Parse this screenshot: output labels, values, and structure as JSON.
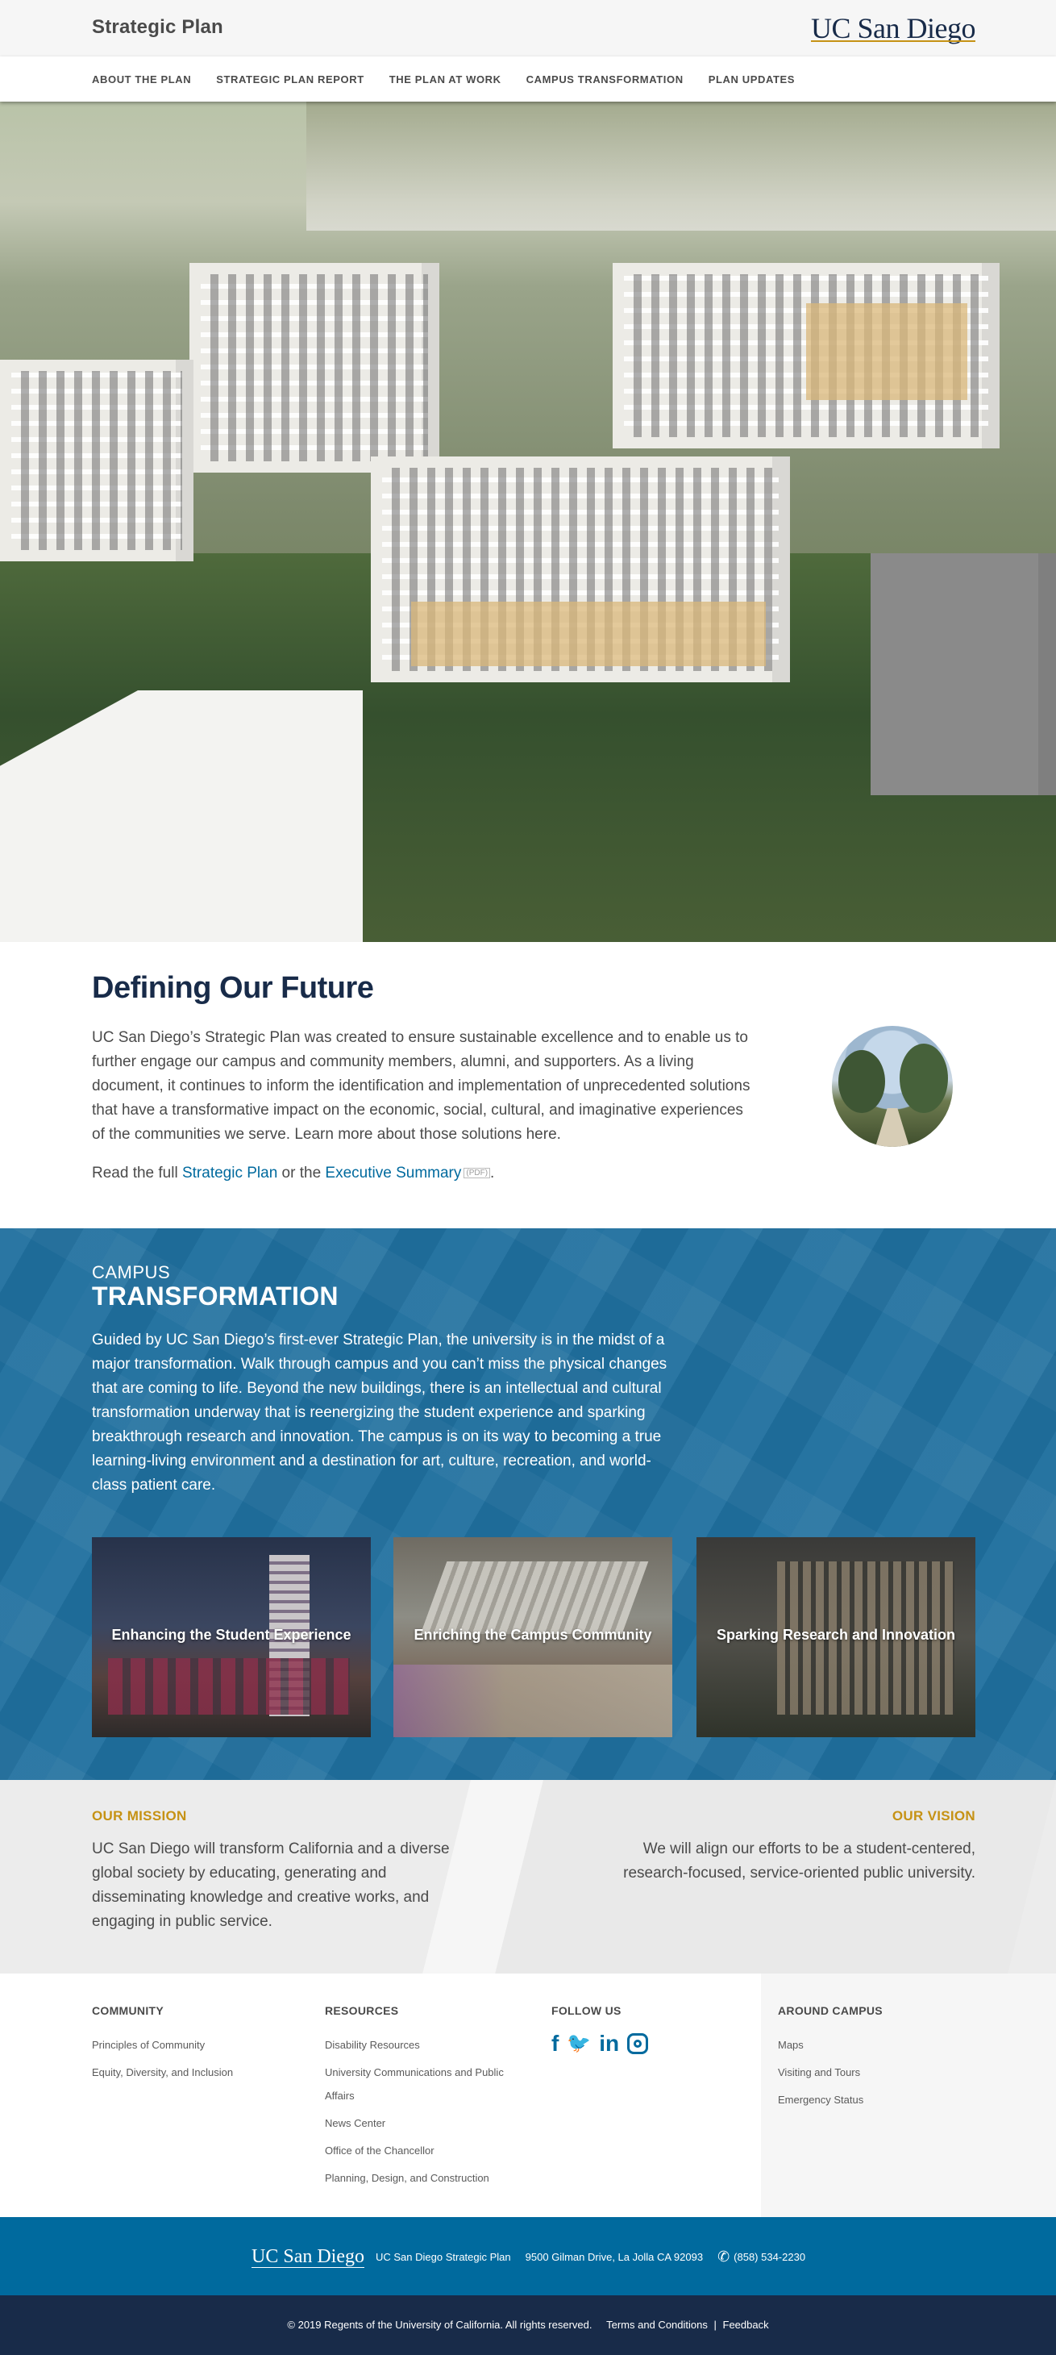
{
  "header": {
    "site_title": "Strategic Plan",
    "logo_text": "UC San Diego"
  },
  "nav": {
    "items": [
      {
        "label": "ABOUT THE PLAN"
      },
      {
        "label": "STRATEGIC PLAN REPORT"
      },
      {
        "label": "THE PLAN AT WORK"
      },
      {
        "label": "CAMPUS TRANSFORMATION"
      },
      {
        "label": "PLAN UPDATES"
      }
    ]
  },
  "intro": {
    "title": "Defining Our Future",
    "text": "UC San Diego’s Strategic Plan was created to ensure sustainable excellence and to enable us to further engage our campus and community members, alumni, and supporters. As a living document, it continues to inform the identification and implementation of unprecedented solutions that have a transformative impact on the economic, social, cultural, and imaginative experiences of the communities we serve. Learn more about those solutions here.",
    "read_prefix": "Read the full",
    "link_plan": "Strategic Plan",
    "read_middle": "or the",
    "link_summary": "Executive Summary",
    "pdf_tag": "(PDF)",
    "read_suffix": "."
  },
  "transformation": {
    "eyebrow": "CAMPUS",
    "title": "TRANSFORMATION",
    "text": "Guided by UC San Diego’s first-ever Strategic Plan, the university is in the midst of a major transformation. Walk through campus and you can’t miss the physical changes that are coming to life. Beyond the new buildings, there is an intellectual and cultural transformation underway that is reenergizing the student experience and sparking breakthrough research and innovation. The campus is on its way to becoming a true learning-living environment and a destination for art, culture, recreation, and world-class patient care.",
    "cards": [
      {
        "label": "Enhancing the Student Experience"
      },
      {
        "label": "Enriching the Campus Community"
      },
      {
        "label": "Sparking Research and Innovation"
      }
    ]
  },
  "mission": {
    "title": "OUR MISSION",
    "text": "UC San Diego will transform California and a diverse global society by educating, generating and disseminating knowledge and creative works, and engaging in public service."
  },
  "vision": {
    "title": "OUR VISION",
    "text": "We will align our efforts to be a student-centered, research-focused, service-oriented public university."
  },
  "footer": {
    "community": {
      "title": "COMMUNITY",
      "links": [
        "Principles of Community",
        "Equity, Diversity, and Inclusion"
      ]
    },
    "resources": {
      "title": "RESOURCES",
      "links": [
        "Disability Resources",
        "University Communications and Public Affairs",
        "News Center",
        "Office of the Chancellor",
        "Planning, Design, and Construction"
      ]
    },
    "follow": {
      "title": "FOLLOW US",
      "icons": [
        "facebook-icon",
        "twitter-icon",
        "linkedin-icon",
        "instagram-icon"
      ],
      "glyphs": {
        "facebook": "f",
        "twitter": "🐦",
        "linkedin": "in"
      }
    },
    "around": {
      "title": "AROUND CAMPUS",
      "links": [
        "Maps",
        "Visiting and Tours",
        "Emergency Status"
      ]
    },
    "bar": {
      "logo_text": "UC San Diego",
      "site_name": "UC San Diego Strategic Plan",
      "address": "9500 Gilman Drive, La Jolla CA 92093",
      "phone": "(858) 534-2230"
    },
    "bottom": {
      "copyright": "© 2019 Regents of the University of California. All rights reserved.",
      "terms": "Terms and Conditions",
      "separator": "|",
      "feedback": "Feedback"
    }
  },
  "colors": {
    "navy": "#182b49",
    "blue": "#006a9e",
    "gold": "#c69214"
  }
}
